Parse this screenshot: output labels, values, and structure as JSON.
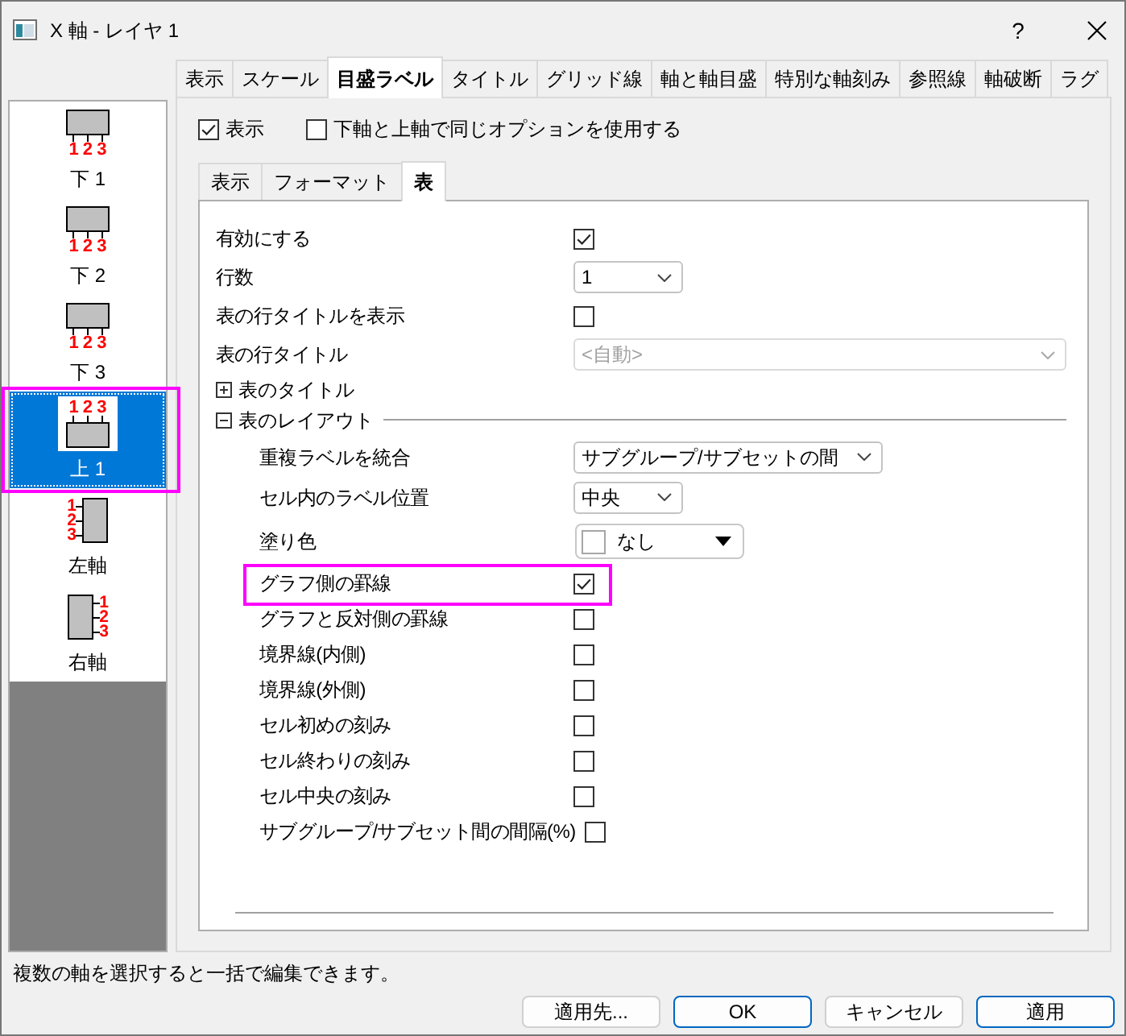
{
  "window": {
    "title": "X 軸 - レイヤ 1",
    "help_button": "?"
  },
  "tabs": [
    {
      "label": "表示",
      "selected": false
    },
    {
      "label": "スケール",
      "selected": false
    },
    {
      "label": "目盛ラベル",
      "selected": true
    },
    {
      "label": "タイトル",
      "selected": false
    },
    {
      "label": "グリッド線",
      "selected": false
    },
    {
      "label": "軸と軸目盛",
      "selected": false
    },
    {
      "label": "特別な軸刻み",
      "selected": false
    },
    {
      "label": "参照線",
      "selected": false
    },
    {
      "label": "軸破断",
      "selected": false
    },
    {
      "label": "ラグ",
      "selected": false
    }
  ],
  "sidebar": {
    "items": [
      {
        "label": "下 1",
        "kind": "bottom",
        "tick_numbers": "123",
        "selected": false,
        "highlighted": false
      },
      {
        "label": "下 2",
        "kind": "bottom",
        "tick_numbers": "123",
        "selected": false,
        "highlighted": false
      },
      {
        "label": "下 3",
        "kind": "bottom",
        "tick_numbers": "123",
        "selected": false,
        "highlighted": false
      },
      {
        "label": "上 1",
        "kind": "top",
        "tick_numbers": "123",
        "selected": true,
        "highlighted": true
      },
      {
        "label": "左軸",
        "kind": "left",
        "tick_numbers": "123",
        "selected": false,
        "highlighted": false
      },
      {
        "label": "右軸",
        "kind": "right",
        "tick_numbers": "123",
        "selected": false,
        "highlighted": false
      }
    ]
  },
  "options": [
    {
      "label": "表示",
      "checked": true
    },
    {
      "label": "下軸と上軸で同じオプションを使用する",
      "checked": false
    }
  ],
  "subtabs": [
    {
      "label": "表示",
      "selected": false
    },
    {
      "label": "フォーマット",
      "selected": false
    },
    {
      "label": "表",
      "selected": true
    }
  ],
  "settings": [
    {
      "kind": "checkbox",
      "label": "有効にする",
      "checked": true,
      "disabled": false,
      "highlighted": false
    },
    {
      "kind": "select",
      "label": "行数",
      "value": "1",
      "disabled": false,
      "highlighted": false
    },
    {
      "kind": "checkbox",
      "label": "表の行タイトルを表示",
      "checked": false,
      "disabled": false,
      "highlighted": false
    },
    {
      "kind": "combo",
      "label": "表の行タイトル",
      "value": "<自動>",
      "disabled": true,
      "highlighted": false
    },
    {
      "kind": "section",
      "label": "表のタイトル",
      "expanded": false,
      "disabled": false,
      "highlighted": false
    },
    {
      "kind": "section",
      "label": "表のレイアウト",
      "expanded": true,
      "disabled": false,
      "highlighted": false,
      "children": [
        {
          "kind": "select",
          "label": "重複ラベルを統合",
          "value": "サブグループ/サブセットの間",
          "disabled": false,
          "highlighted": false
        },
        {
          "kind": "select",
          "label": "セル内のラベル位置",
          "value": "中央",
          "disabled": false,
          "highlighted": false
        },
        {
          "kind": "color",
          "label": "塗り色",
          "value": "なし",
          "disabled": false,
          "highlighted": false
        },
        {
          "kind": "checkbox",
          "label": "グラフ側の罫線",
          "checked": true,
          "disabled": false,
          "highlighted": true
        },
        {
          "kind": "checkbox",
          "label": "グラフと反対側の罫線",
          "checked": false,
          "disabled": false,
          "highlighted": false
        },
        {
          "kind": "checkbox",
          "label": "境界線(内側)",
          "checked": false,
          "disabled": false,
          "highlighted": false
        },
        {
          "kind": "checkbox",
          "label": "境界線(外側)",
          "checked": false,
          "disabled": false,
          "highlighted": false
        },
        {
          "kind": "checkbox",
          "label": "セル初めの刻み",
          "checked": false,
          "disabled": false,
          "highlighted": false
        },
        {
          "kind": "checkbox",
          "label": "セル終わりの刻み",
          "checked": false,
          "disabled": false,
          "highlighted": false
        },
        {
          "kind": "checkbox",
          "label": "セル中央の刻み",
          "checked": false,
          "disabled": false,
          "highlighted": false
        },
        {
          "kind": "checkbox",
          "label": "サブグループ/サブセット間の間隔(%)",
          "checked": false,
          "disabled": false,
          "highlighted": false
        }
      ]
    }
  ],
  "status_text": "複数の軸を選択すると一括で編集できます。",
  "buttons": [
    {
      "label": "適用先...",
      "emphasized": false
    },
    {
      "label": "OK",
      "emphasized": true
    },
    {
      "label": "キャンセル",
      "emphasized": false
    },
    {
      "label": "適用",
      "emphasized": true
    }
  ]
}
